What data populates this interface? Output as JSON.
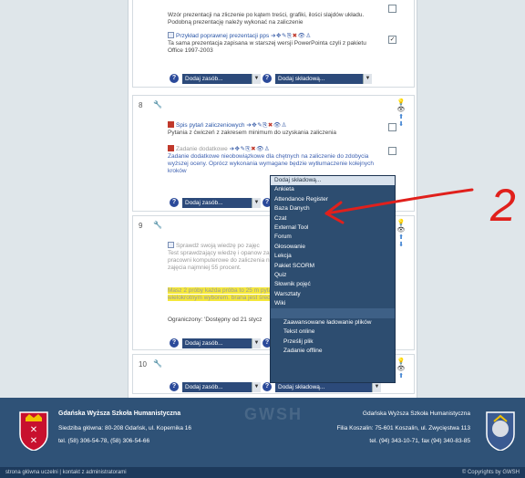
{
  "section_prev": {
    "res1_desc": "Wzór prezentacji na zliczenie po kątem treści, grafiki, ilości slajdów układu. Podobną prezentację należy wykonać na zaliczenie",
    "res2_title": "Przykład poprawnej prezentacji pps",
    "res2_desc": "Ta sama prezentacja zapisana w starszej wersji PowerPointa czyli z pakietu Office 1997-2003",
    "add_resource": "Dodaj zasób...",
    "add_activity": "Dodaj składową..."
  },
  "section8": {
    "number": "8",
    "res1_title": "Spis pytań zaliczeniowych",
    "res1_desc": "Pytania z ćwiczeń z zakresem minimum do uzyskania zaliczenia",
    "res2_title": "Zadanie dodatkowe",
    "res2_desc": "Zadanie dodatkowe nieobowiązkowe dla chętnych na zaliczenie do zdobycia wyższej oceny. Oprócz wykonania wymagane będzie wytłumaczenie kolejnych kroków",
    "add_resource": "Dodaj zasób..."
  },
  "section9": {
    "number": "9",
    "res1_title": "Sprawdź swoją wiedzę po zajęc",
    "res1_desc": "Test sprawdzający wiedzę i opanow zajęciach w pracowni komputerowe do zaliczenia na końcowych zajęcia najmniej 55 procent.",
    "highlight": "Masz 2 próby każda próba to 25 m pytania z wielokrotnym wyborem. brana jest średnia",
    "restricted": "Ograniczony: 'Dostępny od 21 stycz",
    "add_resource": "Dodaj zasób..."
  },
  "section10": {
    "number": "10",
    "add_resource": "Dodaj zasób...",
    "add_activity": "Dodaj składową..."
  },
  "dropdown": {
    "header": "Dodaj składową...",
    "options": [
      "Ankieta",
      "Attendance Register",
      "Baza Danych",
      "Czat",
      "External Tool",
      "Forum",
      "Głosowanie",
      "Lekcja",
      "Pakiet SCORM",
      "Quiz",
      "Słownik pojęć",
      "Warsztaty",
      "Wiki"
    ],
    "assignments": [
      "Zaawansowane ładowanie plików",
      "Tekst online",
      "Prześlij plik",
      "Zadanie offline"
    ]
  },
  "annotation": {
    "number": "2",
    "color": "#e0201c"
  },
  "footer": {
    "left_title": "Gdańska Wyższa Szkoła Humanistyczna",
    "left_address": "Siedziba główna: 80-208 Gdańsk, ul. Kopernika 16",
    "left_phone": "tel. (58) 306-54-78, (58) 306-54-66",
    "right_title": "Gdańska Wyższa Szkoła Humanistyczna",
    "right_address": "Filia Koszalin: 75-601 Koszalin, ul. Zwycięstwa 113",
    "right_phone": "tel. (94) 343-10-71, fax (94) 340-83-85",
    "watermark": "GWSH"
  },
  "bottombar": {
    "links": "strona główna uczelni  |  kontakt z administratorami",
    "copyright": "© Copyrights by GWSH"
  },
  "colors": {
    "footer_bg": "#2f5277",
    "select_bg": "#2c4a7a",
    "highlight": "#f5e83a"
  }
}
